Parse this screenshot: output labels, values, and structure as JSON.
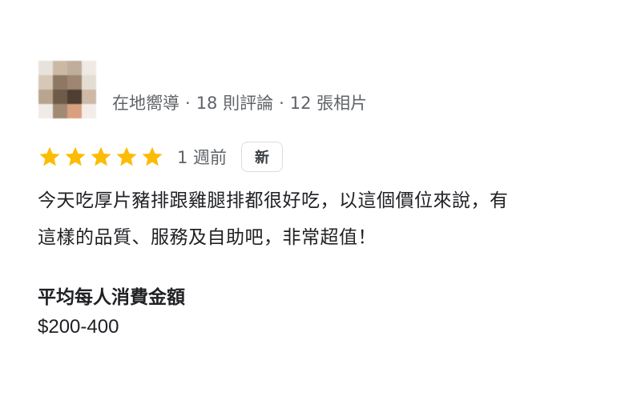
{
  "reviewer": {
    "meta": [
      "在地嚮導",
      "18 則評論",
      "12 張相片"
    ],
    "separator": "·"
  },
  "rating": {
    "stars": 5,
    "max_stars": 5,
    "star_color": "#fbbc04",
    "time_ago": "1 週前",
    "badge": "新"
  },
  "review": {
    "lines": [
      "今天吃厚片豬排跟雞腿排都很好吃，以這個價位來說，有",
      "這樣的品質、服務及自助吧，非常超值！"
    ]
  },
  "price": {
    "title": "平均每人消費金額",
    "value": "$200-400"
  }
}
